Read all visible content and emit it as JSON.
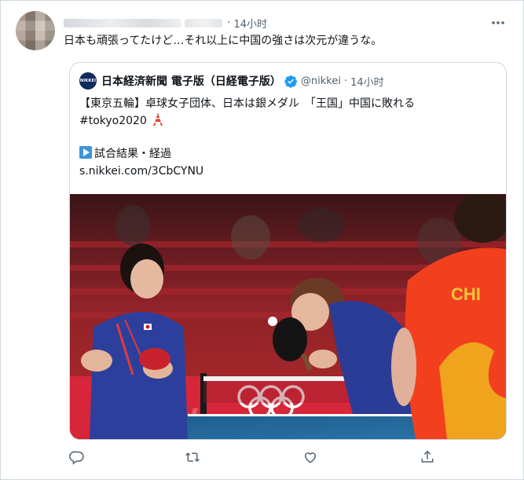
{
  "tweet": {
    "author_name": "",
    "separator": "·",
    "time": "14小时",
    "text": "日本も頑張ってたけど…それ以上に中国の強さは次元が違うな。"
  },
  "quoted": {
    "avatar_text": "NIKKEI",
    "name": "日本経済新聞 電子版（日経電子版）",
    "handle": "@nikkei",
    "separator": "·",
    "time": "14小时",
    "line1": "【東京五輪】卓球女子団体、日本は銀メダル　「王国」中国に敗れる",
    "line2": "#tokyo2020",
    "line3": "試合結果・経過",
    "line4": "s.nikkei.com/3CbCYNU",
    "photo_jersey_text": "CHI"
  },
  "icons": {
    "more": "more-horizontal-icon",
    "reply": "reply-icon",
    "retweet": "retweet-icon",
    "like": "heart-icon",
    "share": "share-icon",
    "verified": "verified-badge-icon",
    "tower": "tokyo-tower-emoji",
    "play": "play-button-emoji"
  },
  "colors": {
    "text": "#0f1419",
    "muted": "#536471",
    "border": "#cfd9de",
    "verified": "#1d9bf0",
    "link": "#0f1419"
  }
}
